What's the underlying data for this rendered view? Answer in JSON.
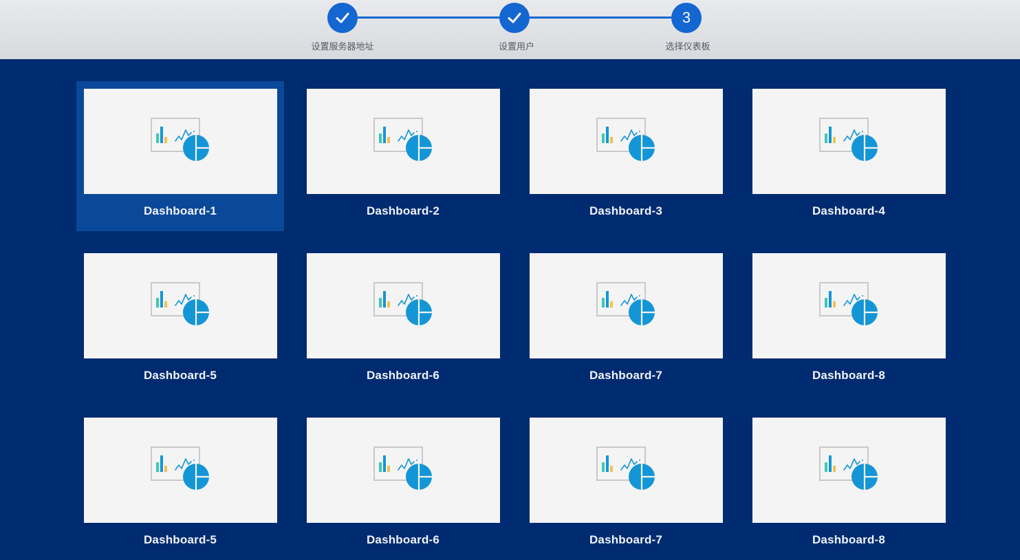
{
  "stepper": {
    "steps": [
      {
        "label": "设置服务器地址",
        "status": "complete"
      },
      {
        "label": "设置用户",
        "status": "complete"
      },
      {
        "label": "选择仪表板",
        "status": "current",
        "number": "3"
      }
    ],
    "accent_color": "#1466d1"
  },
  "dashboards": [
    {
      "label": "Dashboard-1",
      "selected": true
    },
    {
      "label": "Dashboard-2"
    },
    {
      "label": "Dashboard-3"
    },
    {
      "label": "Dashboard-4"
    },
    {
      "label": "Dashboard-5"
    },
    {
      "label": "Dashboard-6"
    },
    {
      "label": "Dashboard-7"
    },
    {
      "label": "Dashboard-8"
    },
    {
      "label": "Dashboard-5"
    },
    {
      "label": "Dashboard-6"
    },
    {
      "label": "Dashboard-7"
    },
    {
      "label": "Dashboard-8"
    }
  ],
  "colors": {
    "background": "#002b70",
    "selected_card": "#0a4899",
    "thumbnail": "#f4f4f4",
    "icon_blue": "#1496d6",
    "icon_teal": "#3fc7b8",
    "icon_yellow": "#f2c14e"
  },
  "icons": {
    "thumbnail": "dashboard-chart-icon",
    "step_complete": "check-icon"
  }
}
